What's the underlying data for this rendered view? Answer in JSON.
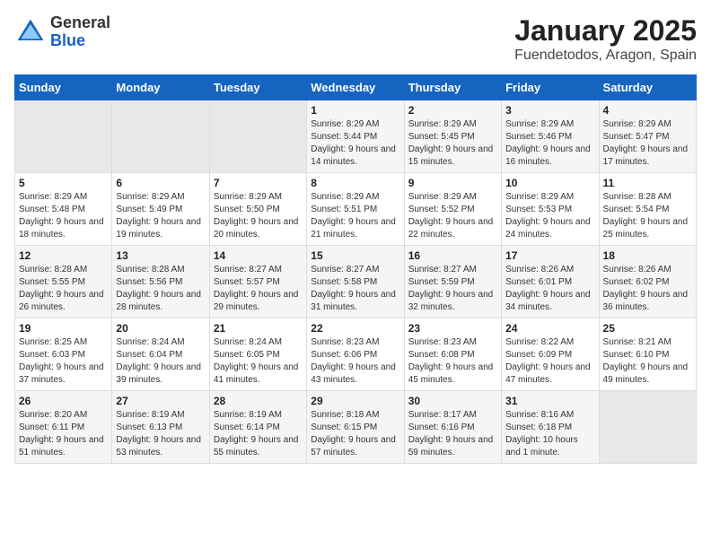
{
  "logo": {
    "general": "General",
    "blue": "Blue"
  },
  "title": "January 2025",
  "subtitle": "Fuendetodos, Aragon, Spain",
  "days_of_week": [
    "Sunday",
    "Monday",
    "Tuesday",
    "Wednesday",
    "Thursday",
    "Friday",
    "Saturday"
  ],
  "weeks": [
    [
      {
        "day": "",
        "info": ""
      },
      {
        "day": "",
        "info": ""
      },
      {
        "day": "",
        "info": ""
      },
      {
        "day": "1",
        "sunrise": "Sunrise: 8:29 AM",
        "sunset": "Sunset: 5:44 PM",
        "daylight": "Daylight: 9 hours and 14 minutes."
      },
      {
        "day": "2",
        "sunrise": "Sunrise: 8:29 AM",
        "sunset": "Sunset: 5:45 PM",
        "daylight": "Daylight: 9 hours and 15 minutes."
      },
      {
        "day": "3",
        "sunrise": "Sunrise: 8:29 AM",
        "sunset": "Sunset: 5:46 PM",
        "daylight": "Daylight: 9 hours and 16 minutes."
      },
      {
        "day": "4",
        "sunrise": "Sunrise: 8:29 AM",
        "sunset": "Sunset: 5:47 PM",
        "daylight": "Daylight: 9 hours and 17 minutes."
      }
    ],
    [
      {
        "day": "5",
        "sunrise": "Sunrise: 8:29 AM",
        "sunset": "Sunset: 5:48 PM",
        "daylight": "Daylight: 9 hours and 18 minutes."
      },
      {
        "day": "6",
        "sunrise": "Sunrise: 8:29 AM",
        "sunset": "Sunset: 5:49 PM",
        "daylight": "Daylight: 9 hours and 19 minutes."
      },
      {
        "day": "7",
        "sunrise": "Sunrise: 8:29 AM",
        "sunset": "Sunset: 5:50 PM",
        "daylight": "Daylight: 9 hours and 20 minutes."
      },
      {
        "day": "8",
        "sunrise": "Sunrise: 8:29 AM",
        "sunset": "Sunset: 5:51 PM",
        "daylight": "Daylight: 9 hours and 21 minutes."
      },
      {
        "day": "9",
        "sunrise": "Sunrise: 8:29 AM",
        "sunset": "Sunset: 5:52 PM",
        "daylight": "Daylight: 9 hours and 22 minutes."
      },
      {
        "day": "10",
        "sunrise": "Sunrise: 8:29 AM",
        "sunset": "Sunset: 5:53 PM",
        "daylight": "Daylight: 9 hours and 24 minutes."
      },
      {
        "day": "11",
        "sunrise": "Sunrise: 8:28 AM",
        "sunset": "Sunset: 5:54 PM",
        "daylight": "Daylight: 9 hours and 25 minutes."
      }
    ],
    [
      {
        "day": "12",
        "sunrise": "Sunrise: 8:28 AM",
        "sunset": "Sunset: 5:55 PM",
        "daylight": "Daylight: 9 hours and 26 minutes."
      },
      {
        "day": "13",
        "sunrise": "Sunrise: 8:28 AM",
        "sunset": "Sunset: 5:56 PM",
        "daylight": "Daylight: 9 hours and 28 minutes."
      },
      {
        "day": "14",
        "sunrise": "Sunrise: 8:27 AM",
        "sunset": "Sunset: 5:57 PM",
        "daylight": "Daylight: 9 hours and 29 minutes."
      },
      {
        "day": "15",
        "sunrise": "Sunrise: 8:27 AM",
        "sunset": "Sunset: 5:58 PM",
        "daylight": "Daylight: 9 hours and 31 minutes."
      },
      {
        "day": "16",
        "sunrise": "Sunrise: 8:27 AM",
        "sunset": "Sunset: 5:59 PM",
        "daylight": "Daylight: 9 hours and 32 minutes."
      },
      {
        "day": "17",
        "sunrise": "Sunrise: 8:26 AM",
        "sunset": "Sunset: 6:01 PM",
        "daylight": "Daylight: 9 hours and 34 minutes."
      },
      {
        "day": "18",
        "sunrise": "Sunrise: 8:26 AM",
        "sunset": "Sunset: 6:02 PM",
        "daylight": "Daylight: 9 hours and 36 minutes."
      }
    ],
    [
      {
        "day": "19",
        "sunrise": "Sunrise: 8:25 AM",
        "sunset": "Sunset: 6:03 PM",
        "daylight": "Daylight: 9 hours and 37 minutes."
      },
      {
        "day": "20",
        "sunrise": "Sunrise: 8:24 AM",
        "sunset": "Sunset: 6:04 PM",
        "daylight": "Daylight: 9 hours and 39 minutes."
      },
      {
        "day": "21",
        "sunrise": "Sunrise: 8:24 AM",
        "sunset": "Sunset: 6:05 PM",
        "daylight": "Daylight: 9 hours and 41 minutes."
      },
      {
        "day": "22",
        "sunrise": "Sunrise: 8:23 AM",
        "sunset": "Sunset: 6:06 PM",
        "daylight": "Daylight: 9 hours and 43 minutes."
      },
      {
        "day": "23",
        "sunrise": "Sunrise: 8:23 AM",
        "sunset": "Sunset: 6:08 PM",
        "daylight": "Daylight: 9 hours and 45 minutes."
      },
      {
        "day": "24",
        "sunrise": "Sunrise: 8:22 AM",
        "sunset": "Sunset: 6:09 PM",
        "daylight": "Daylight: 9 hours and 47 minutes."
      },
      {
        "day": "25",
        "sunrise": "Sunrise: 8:21 AM",
        "sunset": "Sunset: 6:10 PM",
        "daylight": "Daylight: 9 hours and 49 minutes."
      }
    ],
    [
      {
        "day": "26",
        "sunrise": "Sunrise: 8:20 AM",
        "sunset": "Sunset: 6:11 PM",
        "daylight": "Daylight: 9 hours and 51 minutes."
      },
      {
        "day": "27",
        "sunrise": "Sunrise: 8:19 AM",
        "sunset": "Sunset: 6:13 PM",
        "daylight": "Daylight: 9 hours and 53 minutes."
      },
      {
        "day": "28",
        "sunrise": "Sunrise: 8:19 AM",
        "sunset": "Sunset: 6:14 PM",
        "daylight": "Daylight: 9 hours and 55 minutes."
      },
      {
        "day": "29",
        "sunrise": "Sunrise: 8:18 AM",
        "sunset": "Sunset: 6:15 PM",
        "daylight": "Daylight: 9 hours and 57 minutes."
      },
      {
        "day": "30",
        "sunrise": "Sunrise: 8:17 AM",
        "sunset": "Sunset: 6:16 PM",
        "daylight": "Daylight: 9 hours and 59 minutes."
      },
      {
        "day": "31",
        "sunrise": "Sunrise: 8:16 AM",
        "sunset": "Sunset: 6:18 PM",
        "daylight": "Daylight: 10 hours and 1 minute."
      },
      {
        "day": "",
        "info": ""
      }
    ]
  ]
}
